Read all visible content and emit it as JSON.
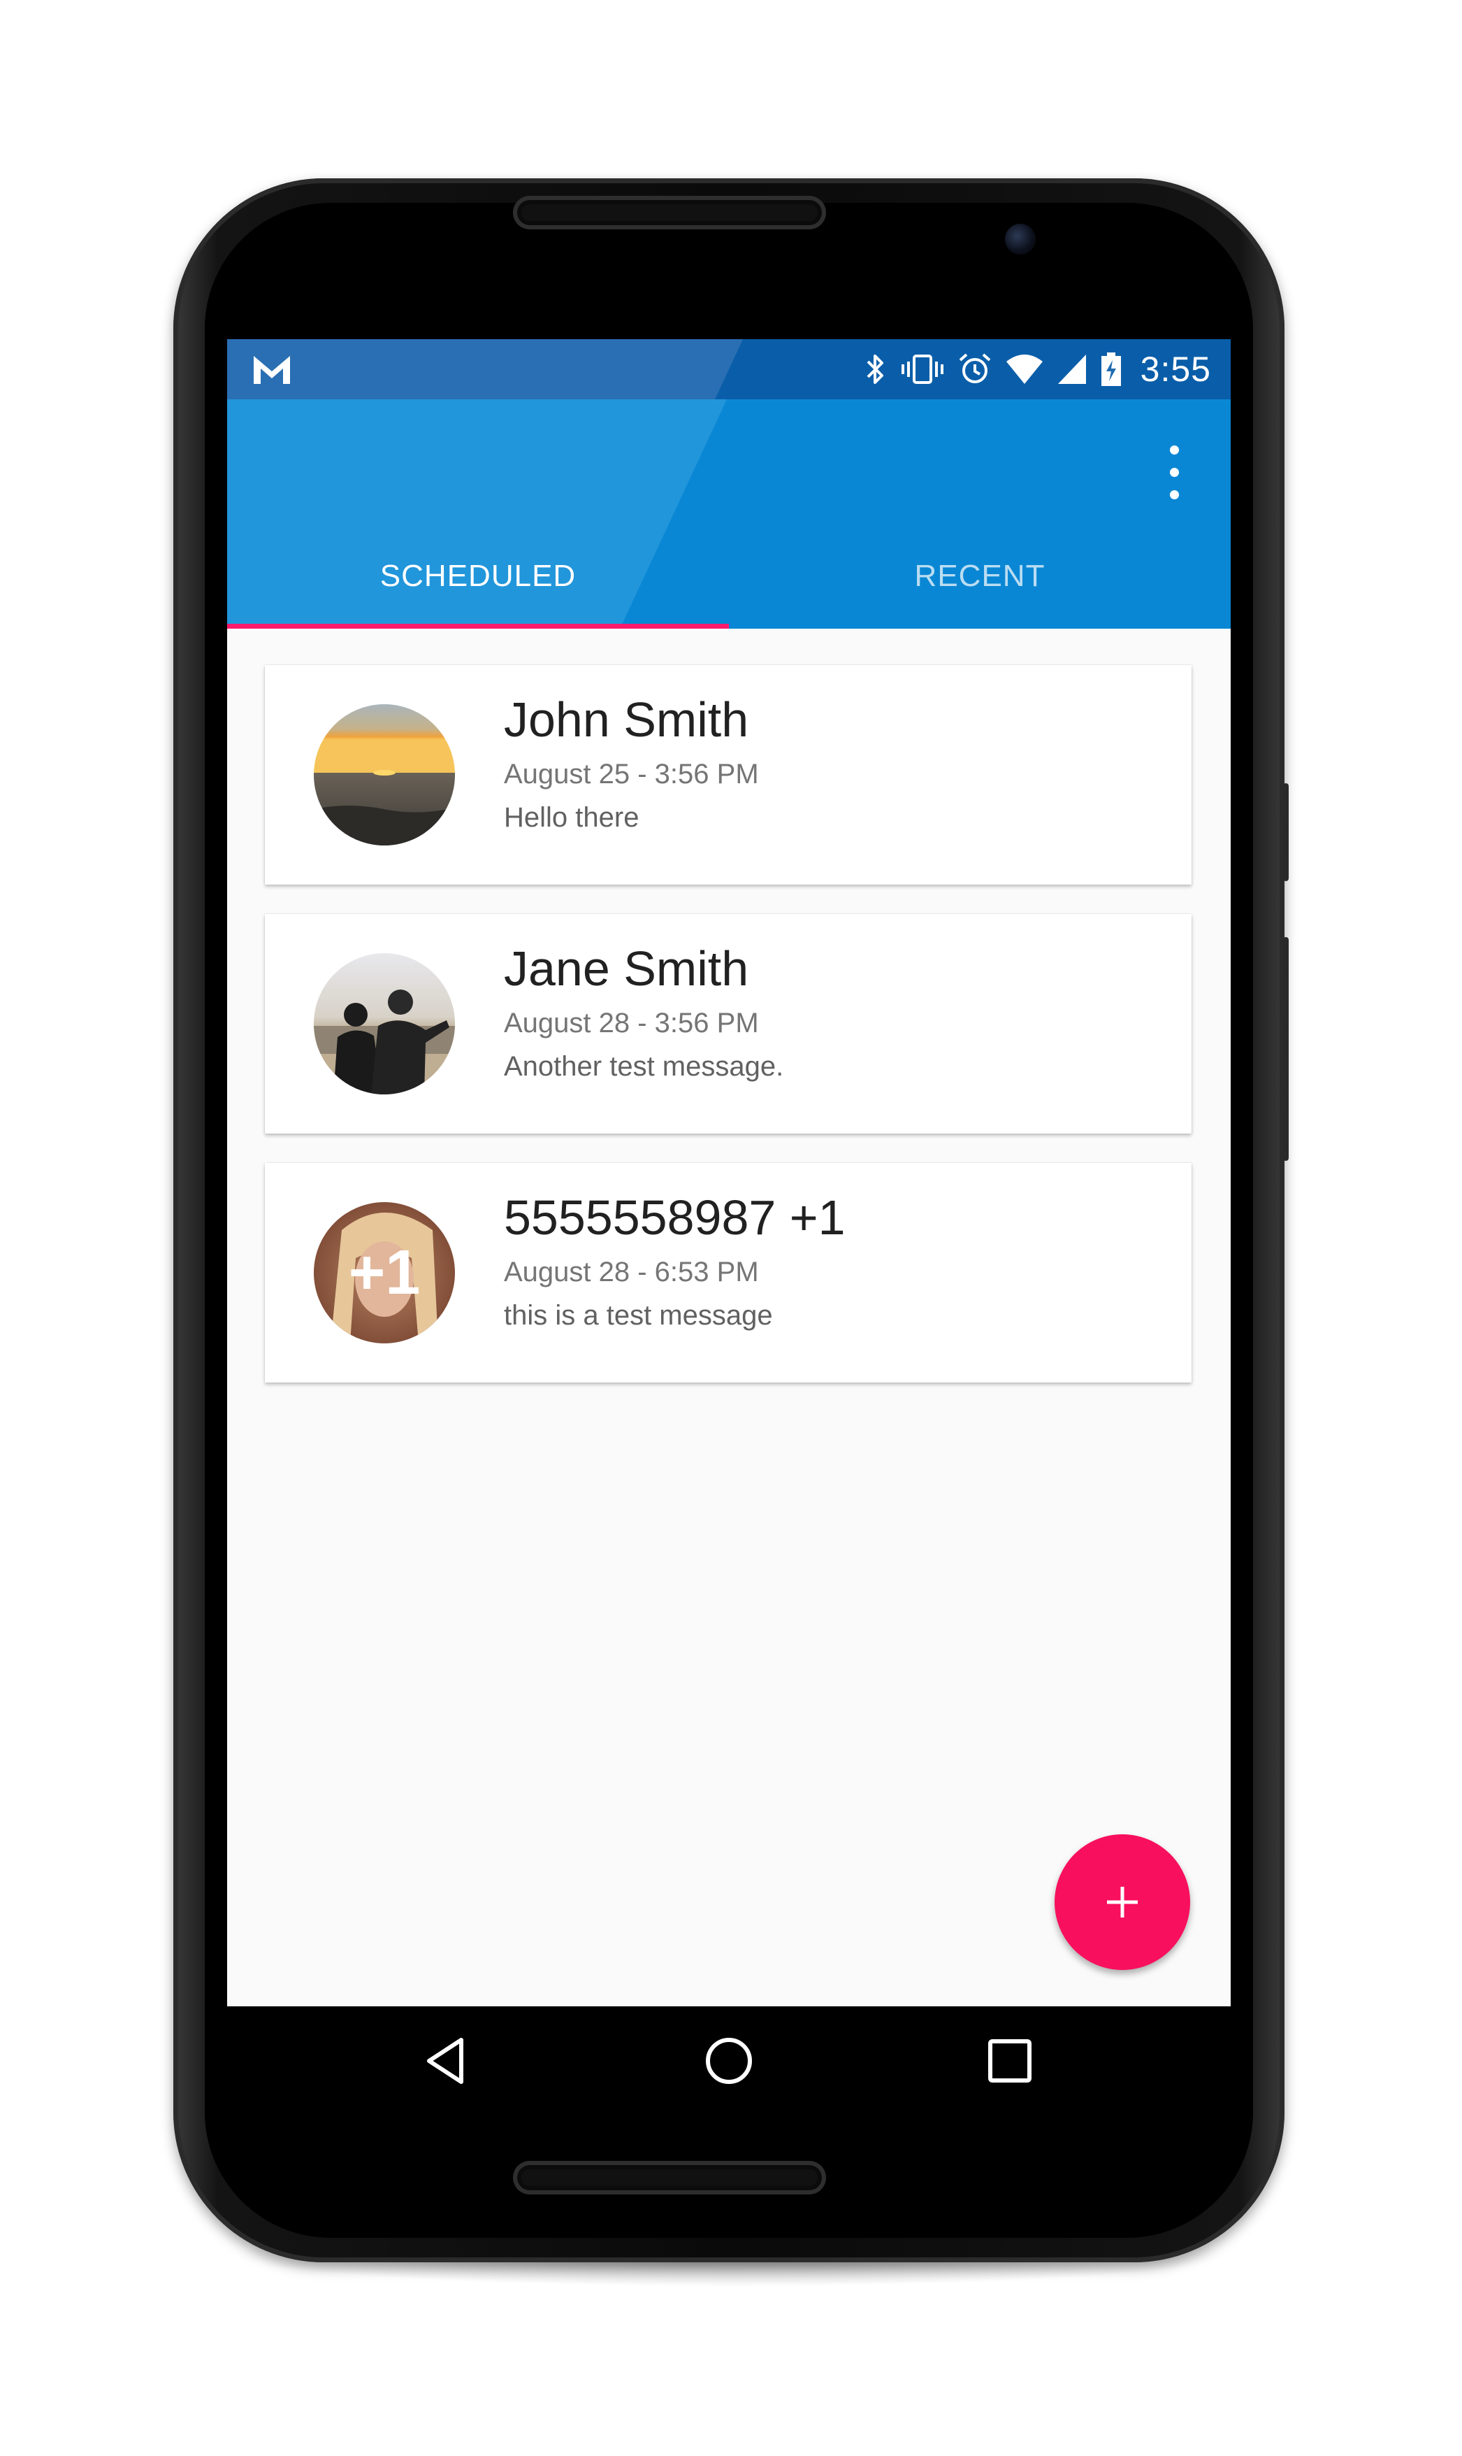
{
  "status_bar": {
    "app_notification_icon": "gmail-m-icon",
    "icons": [
      "bluetooth-icon",
      "vibrate-icon",
      "alarm-icon",
      "wifi-icon",
      "cell-signal-icon",
      "battery-charging-icon"
    ],
    "time": "3:55"
  },
  "app_bar": {
    "overflow_icon": "more-vert-icon",
    "tabs": [
      {
        "label": "SCHEDULED",
        "active": true
      },
      {
        "label": "RECENT",
        "active": false
      }
    ],
    "accent_color": "#ff1a6b"
  },
  "messages": [
    {
      "name": "John Smith",
      "datetime": "August 25 - 3:56 PM",
      "message": "Hello there",
      "avatar": "sunset-beach-photo"
    },
    {
      "name": "Jane Smith",
      "datetime": "August 28 - 3:56 PM",
      "message": "Another test message.",
      "avatar": "couple-at-beach-photo"
    },
    {
      "name": "5555558987 +1",
      "datetime": "August 28 - 6:53 PM",
      "message": "this is a test message",
      "avatar": "woman-portrait-photo",
      "avatar_badge": "+1"
    }
  ],
  "fab": {
    "icon": "plus-icon",
    "color": "#f80f5e"
  },
  "nav_bar": {
    "icons": [
      "back-icon",
      "home-icon",
      "recents-icon"
    ]
  }
}
